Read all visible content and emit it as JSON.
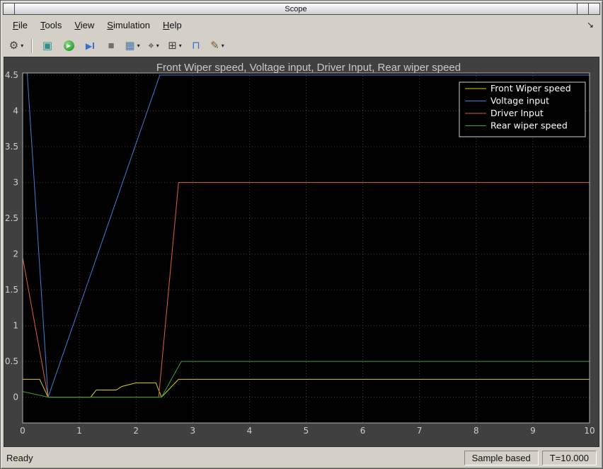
{
  "window": {
    "title": "Scope",
    "statusbar": {
      "ready": "Ready",
      "sample_mode": "Sample based",
      "time": "T=10.000"
    }
  },
  "menubar": {
    "items": [
      {
        "label": "File"
      },
      {
        "label": "Tools"
      },
      {
        "label": "View"
      },
      {
        "label": "Simulation"
      },
      {
        "label": "Help"
      }
    ],
    "dock_icon": "↘"
  },
  "toolbar": {
    "dropdown_arrow": "▾",
    "buttons": [
      {
        "name": "settings-button",
        "icon": "gear-icon",
        "glyph": "⚙",
        "color": "#3f3f3f",
        "dropdown": true
      },
      {
        "separator": true
      },
      {
        "name": "highlight-block-button",
        "icon": "highlight-block-icon",
        "glyph": "▣",
        "color": "#2f9090"
      },
      {
        "name": "run-button",
        "icon": "run-icon",
        "glyph": "▶",
        "color": "#168a16"
      },
      {
        "name": "step-forward-button",
        "icon": "step-forward-icon",
        "glyph": "▶",
        "color": "#3a6fd0"
      },
      {
        "name": "stop-button",
        "icon": "stop-icon",
        "glyph": "■",
        "color": "#707070"
      },
      {
        "name": "stepping-options-button",
        "icon": "layout-grid-icon",
        "glyph": "▦",
        "color": "#4a7ab0",
        "dropdown": true
      },
      {
        "name": "measurements-button",
        "icon": "cursor-measurements-icon",
        "glyph": "⌖",
        "color": "#3f3f3f",
        "dropdown": true
      },
      {
        "name": "zoom-fit-button",
        "icon": "zoom-fit-icon",
        "glyph": "⊞",
        "color": "#3f3f3f",
        "dropdown": true
      },
      {
        "name": "stairs-button",
        "icon": "stairstep-icon",
        "glyph": "⊓",
        "color": "#3a6fd0"
      },
      {
        "name": "style-brush-button",
        "icon": "brush-icon",
        "glyph": "✎",
        "color": "#7a5a30",
        "dropdown": true
      }
    ]
  },
  "chart_data": {
    "type": "line",
    "title": "Front Wiper speed, Voltage input, Driver Input, Rear wiper speed",
    "xlabel": "",
    "ylabel": "",
    "xlim": [
      0,
      10
    ],
    "ylim": [
      -0.36,
      4.53
    ],
    "xticks": [
      0,
      1,
      2,
      3,
      4,
      5,
      6,
      7,
      8,
      9,
      10
    ],
    "yticks": [
      0,
      0.5,
      1,
      1.5,
      2,
      2.5,
      3,
      3.5,
      4,
      4.5
    ],
    "grid": true,
    "legend_position": "top-right",
    "background": "#000000",
    "grid_color": "#5c3434",
    "series": [
      {
        "name": "Front Wiper speed",
        "color": "#d4d400",
        "points": [
          [
            0,
            0.25
          ],
          [
            0.3,
            0.25
          ],
          [
            0.45,
            0
          ],
          [
            1.2,
            0
          ],
          [
            1.3,
            0.1
          ],
          [
            1.65,
            0.1
          ],
          [
            1.75,
            0.15
          ],
          [
            2.0,
            0.2
          ],
          [
            2.35,
            0.2
          ],
          [
            2.45,
            0
          ],
          [
            2.75,
            0.25
          ],
          [
            10,
            0.25
          ]
        ]
      },
      {
        "name": "Voltage input",
        "color": "#3f7fd4",
        "points": [
          [
            0.08,
            4.53
          ],
          [
            0.45,
            0
          ],
          [
            2.42,
            4.5
          ],
          [
            10,
            4.5
          ]
        ]
      },
      {
        "name": "Driver Input",
        "color": "#e0603f",
        "points": [
          [
            0,
            1.95
          ],
          [
            0.45,
            0
          ],
          [
            2.4,
            0
          ],
          [
            2.75,
            3
          ],
          [
            10,
            3
          ]
        ]
      },
      {
        "name": "Rear wiper speed",
        "color": "#36a336",
        "points": [
          [
            0,
            0.08
          ],
          [
            0.45,
            0
          ],
          [
            2.45,
            0
          ],
          [
            2.8,
            0.5
          ],
          [
            10,
            0.5
          ]
        ]
      }
    ]
  }
}
